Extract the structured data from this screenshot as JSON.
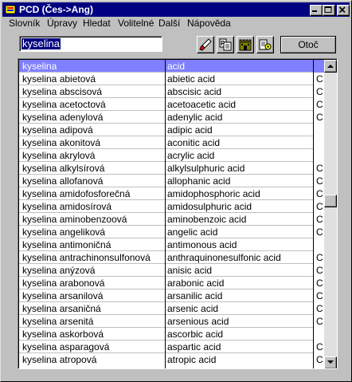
{
  "window": {
    "title": "PCD (Čes->Ang)"
  },
  "menu": [
    "Slovník",
    "Úpravy",
    "Hledat",
    "Volitelné",
    "Další",
    "Nápověda"
  ],
  "search": {
    "value": "kyselina"
  },
  "toolbar": {
    "otoc_label": "Otoč"
  },
  "list": {
    "rows": [
      {
        "cz": "kyselina",
        "en": "acid",
        "mark": ""
      },
      {
        "cz": "kyselina abietová",
        "en": "abietic acid",
        "mark": "C"
      },
      {
        "cz": "kyselina abscisová",
        "en": "abscisic acid",
        "mark": "C"
      },
      {
        "cz": "kyselina acetoctová",
        "en": "acetoacetic acid",
        "mark": "C"
      },
      {
        "cz": "kyselina adenylová",
        "en": "adenylic acid",
        "mark": "C"
      },
      {
        "cz": "kyselina adipová",
        "en": "adipic acid",
        "mark": ""
      },
      {
        "cz": "kyselina akonitová",
        "en": "aconitic acid",
        "mark": ""
      },
      {
        "cz": "kyselina akrylová",
        "en": "acrylic acid",
        "mark": ""
      },
      {
        "cz": "kyselina alkylsírová",
        "en": "alkylsulphuric acid",
        "mark": "C"
      },
      {
        "cz": "kyselina allofanová",
        "en": "allophanic acid",
        "mark": "C"
      },
      {
        "cz": "kyselina amidofosforečná",
        "en": "amidophosphoric acid",
        "mark": "C"
      },
      {
        "cz": "kyselina amidosírová",
        "en": "amidosulphuric acid",
        "mark": "C"
      },
      {
        "cz": "kyselina aminobenzoová",
        "en": "aminobenzoic acid",
        "mark": "C"
      },
      {
        "cz": "kyselina angeliková",
        "en": "angelic acid",
        "mark": "C"
      },
      {
        "cz": "kyselina antimoničná",
        "en": "antimonous acid",
        "mark": ""
      },
      {
        "cz": "kyselina antrachinonsulfonová",
        "en": "anthraquinonesulfonic acid",
        "mark": "C"
      },
      {
        "cz": "kyselina anýzová",
        "en": "anisic acid",
        "mark": "C"
      },
      {
        "cz": "kyselina arabonová",
        "en": "arabonic acid",
        "mark": "C"
      },
      {
        "cz": "kyselina arsanilová",
        "en": "arsanilic acid",
        "mark": "C"
      },
      {
        "cz": "kyselina arsaničná",
        "en": "arsenic acid",
        "mark": "C"
      },
      {
        "cz": "kyselina arsenitá",
        "en": "arsenious acid",
        "mark": "C"
      },
      {
        "cz": "kyselina askorbová",
        "en": "ascorbic acid",
        "mark": ""
      },
      {
        "cz": "kyselina asparagová",
        "en": "aspartic acid",
        "mark": "C"
      },
      {
        "cz": "kyselina atropová",
        "en": "atropic acid",
        "mark": "C"
      }
    ]
  },
  "scrollbar": {
    "position": 0.45
  },
  "colors": {
    "titlebar": "#000080",
    "selection": "#7f7fff",
    "face": "#c0c0c0"
  }
}
